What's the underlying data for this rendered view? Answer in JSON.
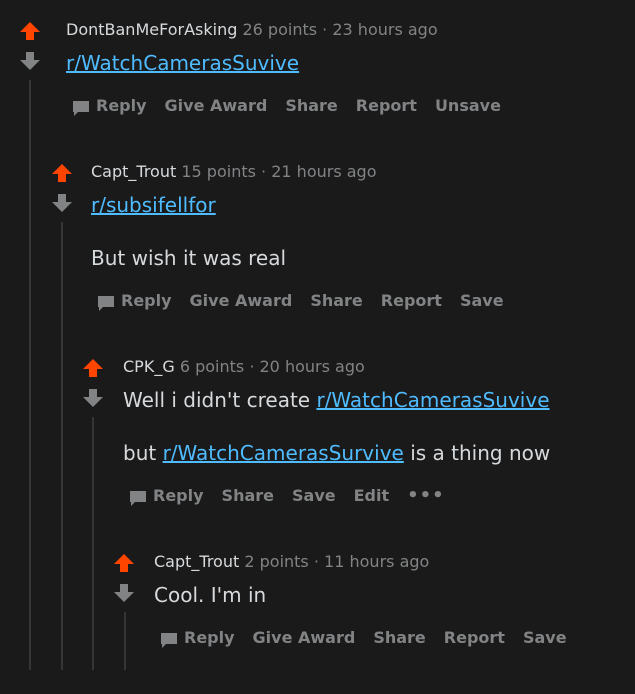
{
  "comments": [
    {
      "author": "DontBanMeForAsking",
      "points": "26 points",
      "sep": "·",
      "time": "23 hours ago",
      "link": "r/WatchCamerasSuvive",
      "actions": {
        "reply": "Reply",
        "give_award": "Give Award",
        "share": "Share",
        "report": "Report",
        "save": "Unsave"
      }
    },
    {
      "author": "Capt_Trout",
      "points": "15 points",
      "sep": "·",
      "time": "21 hours ago",
      "link": "r/subsifellfor",
      "text": "But wish it was real",
      "actions": {
        "reply": "Reply",
        "give_award": "Give Award",
        "share": "Share",
        "report": "Report",
        "save": "Save"
      }
    },
    {
      "author": "CPK_G",
      "points": "6 points",
      "sep": "·",
      "time": "20 hours ago",
      "line1_prefix": "Well i didn't create ",
      "line1_link": "r/WatchCamerasSuvive",
      "line2_prefix": "but ",
      "line2_link": "r/WatchCamerasSurvive",
      "line2_suffix": " is a thing now",
      "actions": {
        "reply": "Reply",
        "share": "Share",
        "save": "Save",
        "edit": "Edit",
        "more": "•••"
      }
    },
    {
      "author": "Capt_Trout",
      "points": "2 points",
      "sep": "·",
      "time": "11 hours ago",
      "text": "Cool. I'm in",
      "actions": {
        "reply": "Reply",
        "give_award": "Give Award",
        "share": "Share",
        "report": "Report",
        "save": "Save"
      }
    }
  ],
  "colors": {
    "upvote": "#ff4500",
    "downvote": "#818384",
    "link": "#4fbcff",
    "thread_line": "#343536",
    "background": "#1a1a1b"
  }
}
